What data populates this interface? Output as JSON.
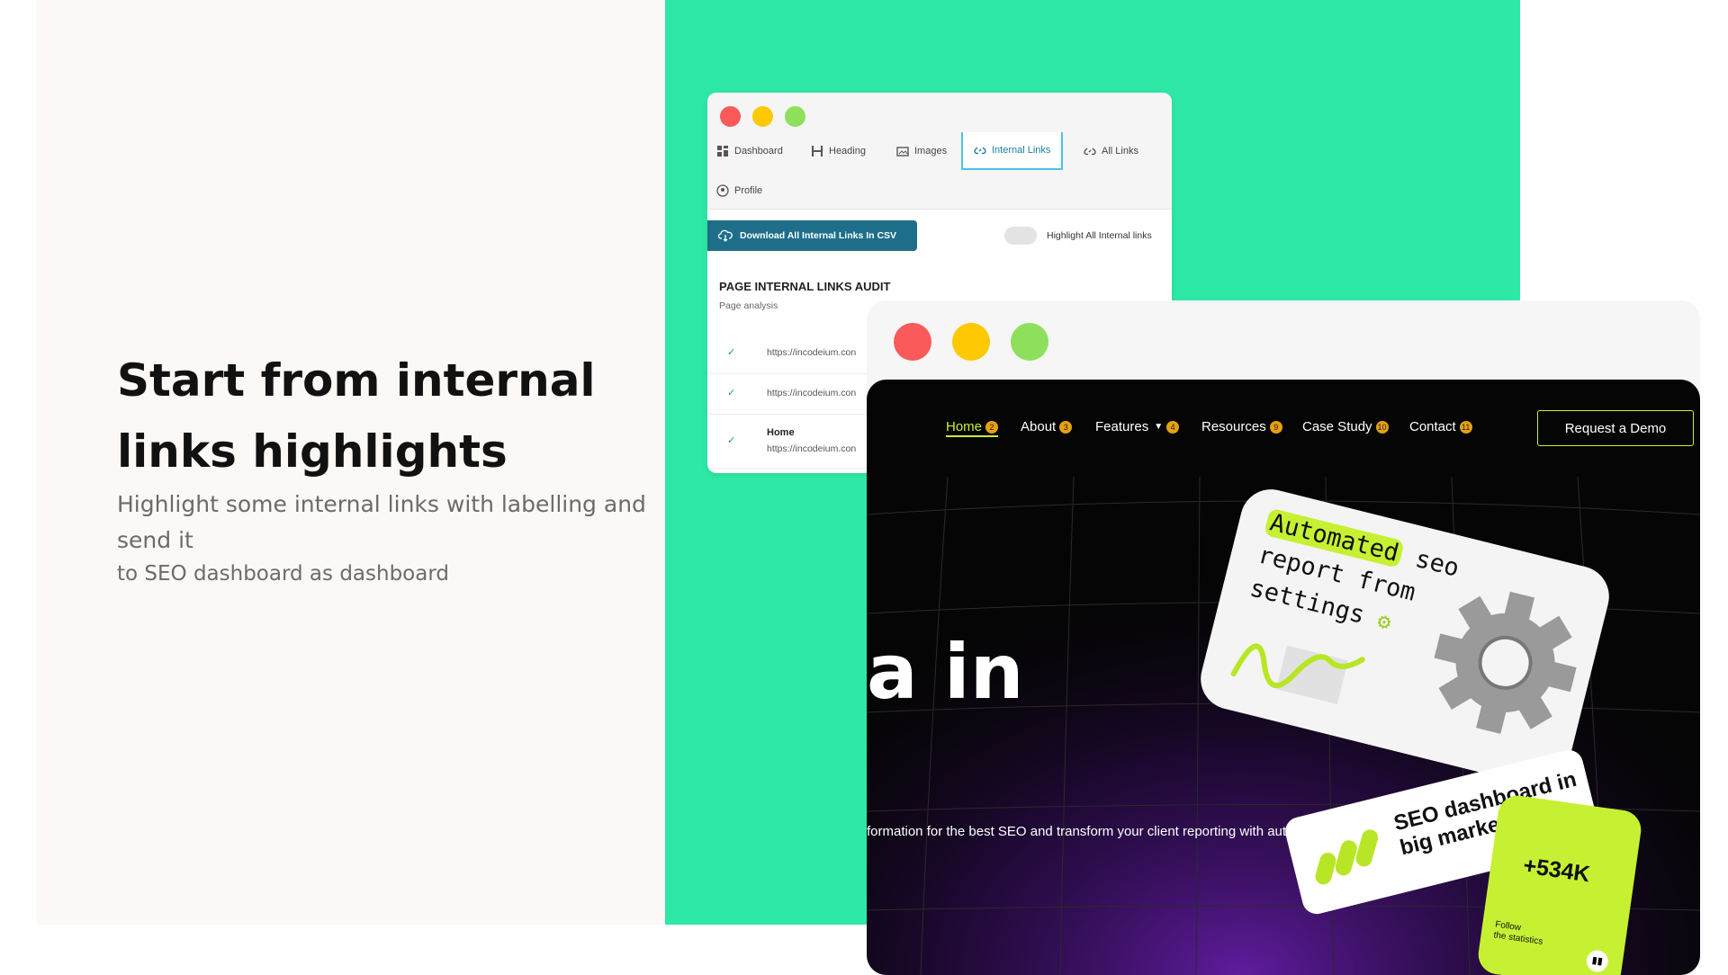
{
  "colors": {
    "left_bg": "#fcf8f5",
    "green_bg": "#2ee8a6",
    "accent_lime": "#c6f133",
    "button_blue": "#1e6e8a",
    "dot_red": "#fa5a5a",
    "dot_yellow": "#fec803",
    "dot_green": "#8ee05c"
  },
  "intro": {
    "headline": "Start from internal links highlights",
    "subtitle_line1": "Highlight some internal links with labelling and send it",
    "subtitle_line2": "to SEO dashboard as dashboard"
  },
  "window1": {
    "tabs": [
      {
        "label": "Dashboard",
        "icon": "dashboard-icon"
      },
      {
        "label": "Heading",
        "icon": "heading-icon"
      },
      {
        "label": "Images",
        "icon": "images-icon"
      },
      {
        "label": "Internal Links",
        "icon": "link-icon",
        "active": true
      },
      {
        "label": "All Links",
        "icon": "link-icon"
      },
      {
        "label": "Profile",
        "icon": "profile-icon"
      }
    ],
    "download_button": "Download All Internal Links In CSV",
    "toggle_label": "Highlight All Internal links",
    "audit_title": "PAGE INTERNAL LINKS AUDIT",
    "audit_subtitle": "Page analysis",
    "rows": [
      {
        "name": "",
        "url": "https://incodeium.con"
      },
      {
        "name": "",
        "url": "https://incodeium.con"
      },
      {
        "name": "Home",
        "url": "https://incodeium.con"
      }
    ]
  },
  "window2": {
    "nav": [
      {
        "label": "Home",
        "badge": "2",
        "active": true
      },
      {
        "label": "About",
        "badge": "3"
      },
      {
        "label": "Features",
        "badge": "4",
        "dropdown": true
      },
      {
        "label": "Resources",
        "badge": "9"
      },
      {
        "label": "Case Study",
        "badge": "10"
      },
      {
        "label": "Contact",
        "badge": "11"
      }
    ],
    "demo_button": "Request a Demo",
    "hero_word": "a in",
    "hero_line": "formation for the best SEO and transform your client reporting with automation for fast expanding",
    "card_text_highlight": "Automated",
    "card_text_rest1": " seo",
    "card_text_line2": "report from",
    "card_text_line3": "settings",
    "card2_text": "SEO dashboard in big market",
    "card3_value": "+534K",
    "card3_caption_line1": "Follow",
    "card3_caption_line2": "the statistics"
  }
}
